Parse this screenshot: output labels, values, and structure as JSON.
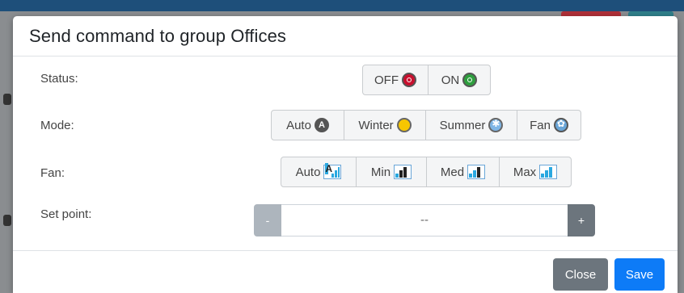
{
  "modal": {
    "title": "Send command to group Offices"
  },
  "status": {
    "label": "Status:",
    "options": [
      {
        "label": "OFF",
        "icon": "power-off-icon",
        "color": "#c8102e"
      },
      {
        "label": "ON",
        "icon": "power-on-icon",
        "color": "#2e9e3e"
      }
    ]
  },
  "mode": {
    "label": "Mode:",
    "options": [
      {
        "label": "Auto",
        "icon": "auto-mode-icon",
        "glyph": "A"
      },
      {
        "label": "Winter",
        "icon": "sun-icon"
      },
      {
        "label": "Summer",
        "icon": "snowflake-icon"
      },
      {
        "label": "Fan",
        "icon": "fan-icon"
      }
    ]
  },
  "fan": {
    "label": "Fan:",
    "options": [
      {
        "label": "Auto",
        "icon": "fan-auto-bars-icon",
        "glyph": "A"
      },
      {
        "label": "Min",
        "icon": "fan-min-bars-icon"
      },
      {
        "label": "Med",
        "icon": "fan-med-bars-icon"
      },
      {
        "label": "Max",
        "icon": "fan-max-bars-icon"
      }
    ]
  },
  "setpoint": {
    "label": "Set point:",
    "decrement": "-",
    "value": "--",
    "increment": "+"
  },
  "footer": {
    "close_label": "Close",
    "save_label": "Save"
  },
  "colors": {
    "primary": "#0d7bf7",
    "secondary": "#6c757d"
  }
}
